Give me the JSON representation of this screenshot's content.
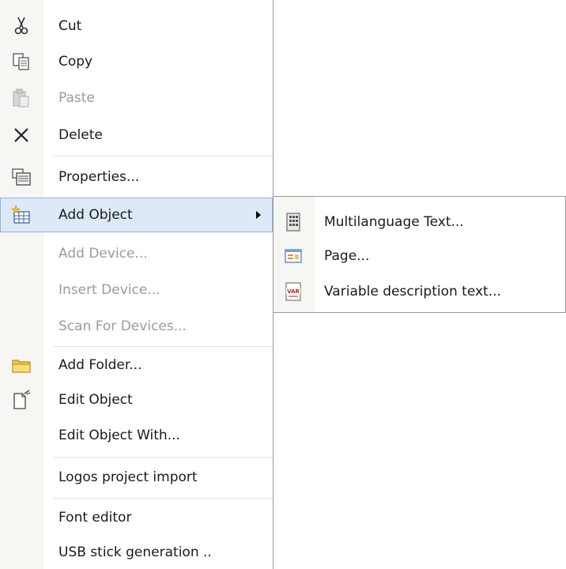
{
  "context_menu": {
    "items": [
      {
        "label": "Cut",
        "icon": "scissors-icon",
        "enabled": true
      },
      {
        "label": "Copy",
        "icon": "copy-icon",
        "enabled": true
      },
      {
        "label": "Paste",
        "icon": "paste-icon",
        "enabled": false
      },
      {
        "label": "Delete",
        "icon": "delete-x-icon",
        "enabled": true
      },
      {
        "label": "Properties...",
        "icon": "properties-icon",
        "enabled": true
      },
      {
        "label": "Add Object",
        "icon": "add-object-icon",
        "enabled": true,
        "highlighted": true,
        "has_submenu": true
      },
      {
        "label": "Add Device...",
        "enabled": false
      },
      {
        "label": "Insert Device...",
        "enabled": false
      },
      {
        "label": "Scan For Devices...",
        "enabled": false
      },
      {
        "label": "Add Folder...",
        "icon": "folder-icon",
        "enabled": true
      },
      {
        "label": "Edit Object",
        "icon": "edit-document-icon",
        "enabled": true
      },
      {
        "label": "Edit Object With...",
        "enabled": true
      },
      {
        "label": "Logos project import",
        "enabled": true
      },
      {
        "label": "Font editor",
        "enabled": true
      },
      {
        "label": "USB stick generation ..",
        "enabled": true
      }
    ]
  },
  "submenu": {
    "items": [
      {
        "label": "Multilanguage Text...",
        "icon": "multilanguage-text-icon"
      },
      {
        "label": "Page...",
        "icon": "page-icon"
      },
      {
        "label": "Variable description text...",
        "icon": "var-text-icon"
      }
    ]
  },
  "colors": {
    "highlight_bg": "#dde9f7",
    "highlight_border": "#8cb4e0",
    "disabled_text": "#9b9b9b",
    "icon_strip": "#f6f6f3"
  }
}
